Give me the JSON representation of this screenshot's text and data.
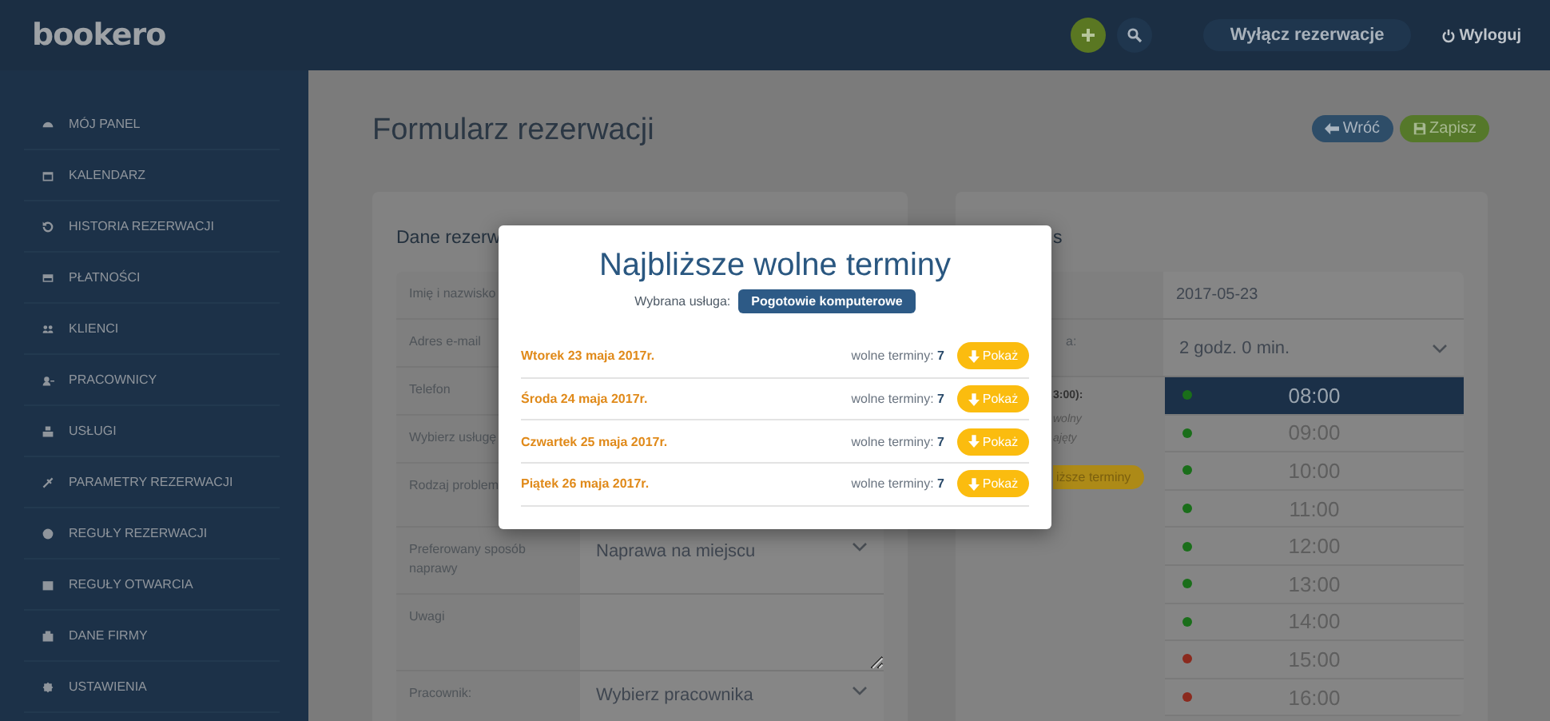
{
  "header": {
    "logo": "bookero",
    "toggle_button": "Wyłącz rezerwacje",
    "logout": "Wyloguj"
  },
  "sidebar": {
    "items": [
      {
        "label": "MÓJ PANEL"
      },
      {
        "label": "KALENDARZ"
      },
      {
        "label": "HISTORIA REZERWACJI"
      },
      {
        "label": "PŁATNOŚCI"
      },
      {
        "label": "KLIENCI"
      },
      {
        "label": "PRACOWNICY"
      },
      {
        "label": "USŁUGI"
      },
      {
        "label": "PARAMETRY REZERWACJI"
      },
      {
        "label": "REGUŁY REZERWACJI"
      },
      {
        "label": "REGUŁY OTWARCIA"
      },
      {
        "label": "DANE FIRMY"
      },
      {
        "label": "USTAWIENIA"
      }
    ]
  },
  "page": {
    "title": "Formularz rezerwacji",
    "back_button": "Wróć",
    "save_button": "Zapisz"
  },
  "booking_card": {
    "heading": "Dane rezerw",
    "rows": [
      {
        "kind": "input",
        "label": "Imię i nazwisko"
      },
      {
        "kind": "input",
        "label": "Adres e-mail"
      },
      {
        "kind": "input",
        "label": "Telefon"
      },
      {
        "kind": "input",
        "label": "Wybierz usługę"
      },
      {
        "kind": "area",
        "label": "Rodzaj problem"
      },
      {
        "kind": "select",
        "label": "Preferowany sposób naprawy",
        "value": "Naprawa na miejscu"
      },
      {
        "kind": "notes",
        "label": "Uwagi"
      },
      {
        "kind": "select",
        "label": "Pracownik:",
        "value": "Wybierz pracownika"
      }
    ]
  },
  "term_card": {
    "heading": "s",
    "date": "2017-05-23",
    "duration_label": "a:",
    "duration": "2 godz. 0 min.",
    "selected_time": "3:00):",
    "legend": [
      "wolny",
      "ajęty"
    ],
    "nearest_button": "iższe terminy",
    "slots": [
      {
        "time": "08:00",
        "color": "#1a6e1a",
        "selected": true
      },
      {
        "time": "09:00",
        "color": "#1a6e1a",
        "selected": false
      },
      {
        "time": "10:00",
        "color": "#1a6e1a",
        "selected": false
      },
      {
        "time": "11:00",
        "color": "#1a6e1a",
        "selected": false
      },
      {
        "time": "12:00",
        "color": "#1a6e1a",
        "selected": false
      },
      {
        "time": "13:00",
        "color": "#1a6e1a",
        "selected": false
      },
      {
        "time": "14:00",
        "color": "#1a6e1a",
        "selected": false
      },
      {
        "time": "15:00",
        "color": "#8b2a1e",
        "selected": false
      },
      {
        "time": "16:00",
        "color": "#8b2a1e",
        "selected": false
      }
    ]
  },
  "modal": {
    "title": "Najbliższe wolne terminy",
    "service_label": "Wybrana usługa:",
    "service": "Pogotowie komputerowe",
    "days": [
      {
        "date": "Wtorek 23 maja 2017r.",
        "count_text": "wolne terminy: **7**",
        "button": "Pokaż"
      },
      {
        "date": "Środa 24 maja 2017r.",
        "count_text": "wolne terminy: **7**",
        "button": "Pokaż"
      },
      {
        "date": "Czwartek 25 maja 2017r.",
        "count_text": "wolne terminy: **7**",
        "button": "Pokaż"
      },
      {
        "date": "Piątek 26 maja 2017r.",
        "count_text": "wolne terminy: **7**",
        "button": "Pokaż"
      }
    ]
  }
}
